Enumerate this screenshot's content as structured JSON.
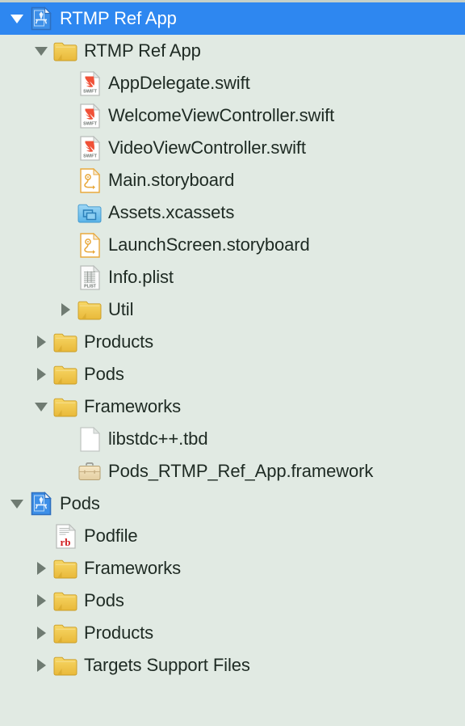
{
  "navigator": {
    "background_color": "#E1EAE3",
    "selection_color": "#2E87F0",
    "selected_row_index": 0,
    "rows": [
      {
        "label": "RTMP Ref App",
        "icon": "xcode-project-icon",
        "depth": 0,
        "twisty": "down",
        "selected": true
      },
      {
        "label": "RTMP Ref App",
        "icon": "folder-icon",
        "depth": 1,
        "twisty": "down",
        "selected": false
      },
      {
        "label": "AppDelegate.swift",
        "icon": "swift-file-icon",
        "depth": 2,
        "twisty": "none",
        "selected": false
      },
      {
        "label": "WelcomeViewController.swift",
        "icon": "swift-file-icon",
        "depth": 2,
        "twisty": "none",
        "selected": false
      },
      {
        "label": "VideoViewController.swift",
        "icon": "swift-file-icon",
        "depth": 2,
        "twisty": "none",
        "selected": false
      },
      {
        "label": "Main.storyboard",
        "icon": "storyboard-file-icon",
        "depth": 2,
        "twisty": "none",
        "selected": false
      },
      {
        "label": "Assets.xcassets",
        "icon": "asset-catalog-icon",
        "depth": 2,
        "twisty": "none",
        "selected": false
      },
      {
        "label": "LaunchScreen.storyboard",
        "icon": "storyboard-file-icon",
        "depth": 2,
        "twisty": "none",
        "selected": false
      },
      {
        "label": "Info.plist",
        "icon": "plist-file-icon",
        "depth": 2,
        "twisty": "none",
        "selected": false
      },
      {
        "label": "Util",
        "icon": "folder-icon",
        "depth": 2,
        "twisty": "right",
        "selected": false
      },
      {
        "label": "Products",
        "icon": "folder-icon",
        "depth": 1,
        "twisty": "right",
        "selected": false
      },
      {
        "label": "Pods",
        "icon": "folder-icon",
        "depth": 1,
        "twisty": "right",
        "selected": false
      },
      {
        "label": "Frameworks",
        "icon": "folder-icon",
        "depth": 1,
        "twisty": "down",
        "selected": false
      },
      {
        "label": "libstdc++.tbd",
        "icon": "generic-file-icon",
        "depth": 2,
        "twisty": "none",
        "selected": false
      },
      {
        "label": "Pods_RTMP_Ref_App.framework",
        "icon": "framework-icon",
        "depth": 2,
        "twisty": "none",
        "selected": false
      },
      {
        "label": "Pods",
        "icon": "xcode-project-icon",
        "depth": 0,
        "twisty": "down",
        "selected": false
      },
      {
        "label": "Podfile",
        "icon": "ruby-file-icon",
        "depth": 1,
        "twisty": "none",
        "selected": false
      },
      {
        "label": "Frameworks",
        "icon": "folder-icon",
        "depth": 1,
        "twisty": "right",
        "selected": false
      },
      {
        "label": "Pods",
        "icon": "folder-icon",
        "depth": 1,
        "twisty": "right",
        "selected": false
      },
      {
        "label": "Products",
        "icon": "folder-icon",
        "depth": 1,
        "twisty": "right",
        "selected": false
      },
      {
        "label": "Targets Support Files",
        "icon": "folder-icon",
        "depth": 1,
        "twisty": "right",
        "selected": false
      }
    ]
  }
}
